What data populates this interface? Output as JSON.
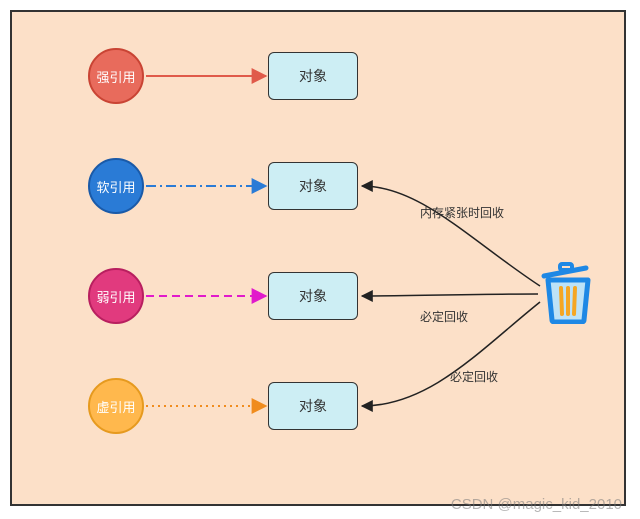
{
  "references": [
    {
      "label": "强引用",
      "target": "对象",
      "arrow_style": "solid",
      "color": "#e05a4a"
    },
    {
      "label": "软引用",
      "target": "对象",
      "arrow_style": "dash-dot",
      "color": "#2a7bd6"
    },
    {
      "label": "弱引用",
      "target": "对象",
      "arrow_style": "dashed",
      "color": "#e11acb"
    },
    {
      "label": "虚引用",
      "target": "对象",
      "arrow_style": "dotted",
      "color": "#f08c1e"
    }
  ],
  "gc_edges": [
    {
      "to_ref_index": 1,
      "label": "内存紧张时回收"
    },
    {
      "to_ref_index": 2,
      "label": "必定回收"
    },
    {
      "to_ref_index": 3,
      "label": "必定回收"
    }
  ],
  "trash_icon": "trash-can",
  "watermark": "CSDN @magic_kid_2010"
}
